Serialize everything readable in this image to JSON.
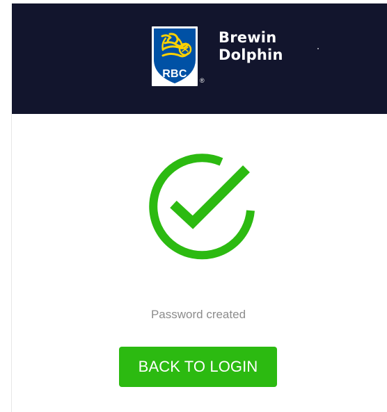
{
  "header": {
    "logo_text": "RBC",
    "registered_mark": "®",
    "brand_line_1": "Brewin",
    "brand_line_2": "Dolphin"
  },
  "status": {
    "icon": "success-check-circle",
    "message": "Password created",
    "icon_color": "#2cba11"
  },
  "actions": {
    "back_to_login_label": "BACK TO LOGIN"
  },
  "colors": {
    "header_background": "#12152d",
    "primary_green": "#2cba11",
    "rbc_blue": "#0051a5",
    "rbc_yellow": "#ffd200",
    "muted_text": "#8c8c8c"
  }
}
